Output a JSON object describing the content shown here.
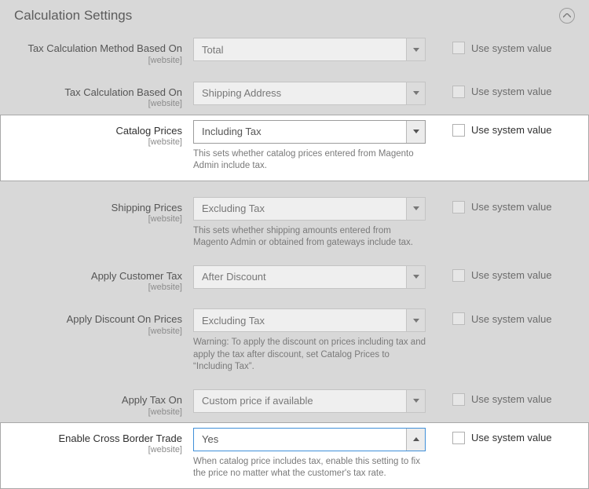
{
  "section_title": "Calculation Settings",
  "use_system_label": "Use system value",
  "rows": [
    {
      "label": "Tax Calculation Method Based On",
      "scope": "[website]",
      "value": "Total",
      "hint": ""
    },
    {
      "label": "Tax Calculation Based On",
      "scope": "[website]",
      "value": "Shipping Address",
      "hint": ""
    },
    {
      "label": "Catalog Prices",
      "scope": "[website]",
      "value": "Including Tax",
      "hint": "This sets whether catalog prices entered from Magento Admin include tax."
    },
    {
      "label": "Shipping Prices",
      "scope": "[website]",
      "value": "Excluding Tax",
      "hint": "This sets whether shipping amounts entered from Magento Admin or obtained from gateways include tax."
    },
    {
      "label": "Apply Customer Tax",
      "scope": "[website]",
      "value": "After Discount",
      "hint": ""
    },
    {
      "label": "Apply Discount On Prices",
      "scope": "[website]",
      "value": "Excluding Tax",
      "hint": "Warning: To apply the discount on prices including tax and apply the tax after discount, set Catalog Prices to “Including Tax”."
    },
    {
      "label": "Apply Tax On",
      "scope": "[website]",
      "value": "Custom price if available",
      "hint": ""
    },
    {
      "label": "Enable Cross Border Trade",
      "scope": "[website]",
      "value": "Yes",
      "hint": "When catalog price includes tax, enable this setting to fix the price no matter what the customer's tax rate."
    }
  ]
}
